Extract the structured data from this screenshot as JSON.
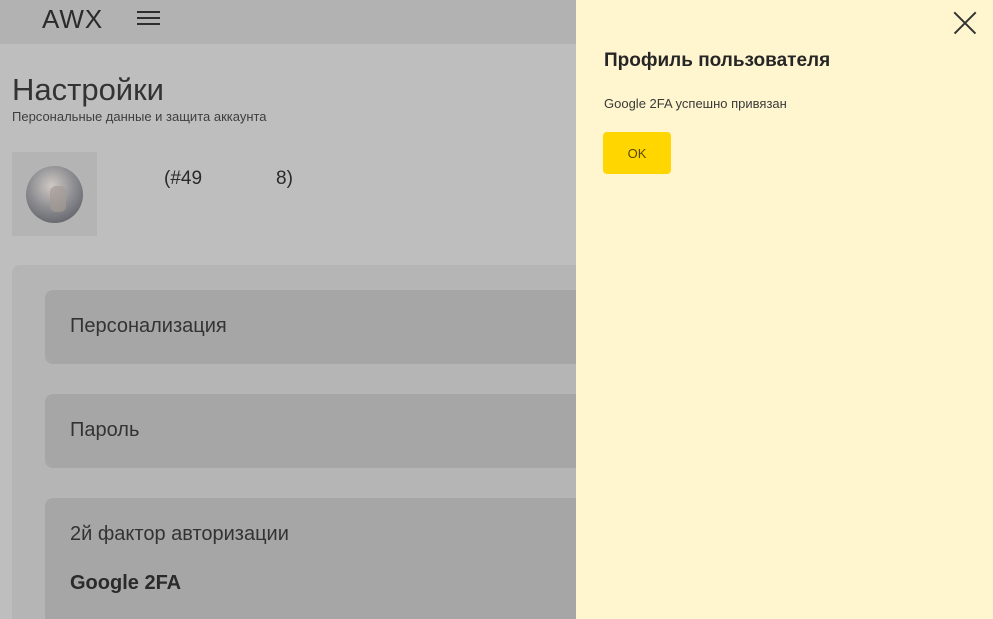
{
  "header": {
    "logo": "AWX",
    "menu_icon": "hamburger-menu-icon"
  },
  "page": {
    "title": "Настройки",
    "subtitle": "Персональные данные и защита аккаунта"
  },
  "user": {
    "avatar_icon": "user-avatar",
    "id_text": "(#49",
    "id_suffix": "8)"
  },
  "settings": {
    "personalization_label": "Персонализация",
    "password_label": "Пароль",
    "two_factor_label": "2й фактор авторизации",
    "two_factor_value": "Google 2FA"
  },
  "modal": {
    "title": "Профиль пользователя",
    "message": "Google 2FA успешно привязан",
    "ok_label": "OK",
    "close_icon": "close-icon",
    "background_color": "#fff6cf",
    "button_color": "#ffd600"
  }
}
